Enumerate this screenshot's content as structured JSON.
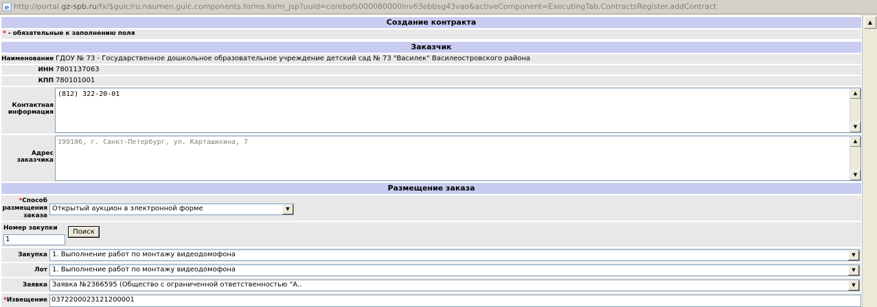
{
  "address_bar": {
    "url_prefix": "http://portal.",
    "url_domain": "gz-spb.ru",
    "url_rest": "/fx/$guic/ru.naumen.guic.components.forms.form_jsp?uuid=corebofs000080000inv63ebbsg43vao&activeComponent=ExecutingTab.ContractsRegister.addContract"
  },
  "form": {
    "title": "Создание контракта",
    "required_star": "*",
    "required_note": " - обязательные к заполнению поля"
  },
  "customer": {
    "section_title": "Заказчик",
    "name_label": "Наименование",
    "name_value": "ГДОУ № 73 - Государственное дошкольное образовательное учреждение детский сад № 73 \"Василек\" Василеостровского района",
    "inn_label": "ИНН",
    "inn_value": "7801137063",
    "kpp_label": "КПП",
    "kpp_value": "780101001",
    "contact_label": "Контактная информация",
    "contact_value": "(812) 322-20-01",
    "address_label": "Адрес заказчика",
    "address_value": "199106, г. Санкт-Петербург, ул. Карташихина, 7"
  },
  "placement": {
    "section_title": "Размещение заказа",
    "method_star": "*",
    "method_label": "Способ размещения заказа",
    "method_value": "Открытый аукцион в электронной форме",
    "purchase_number_label": "Номер закупки",
    "purchase_number_value": "1",
    "search_button": "Поиск",
    "purchase_label": "Закупка",
    "purchase_value": "1. Выполнение работ по монтажу видеодомофона",
    "lot_label": "Лот",
    "lot_value": "1. Выполнение работ по монтажу видеодомофона",
    "application_label": "Заявка",
    "application_value": "Заявка №2366595 (Общество с ограниченной ответственностью \"А..",
    "notice_star": "*",
    "notice_label": "Извещение",
    "notice_value": "0372200023121200001"
  }
}
